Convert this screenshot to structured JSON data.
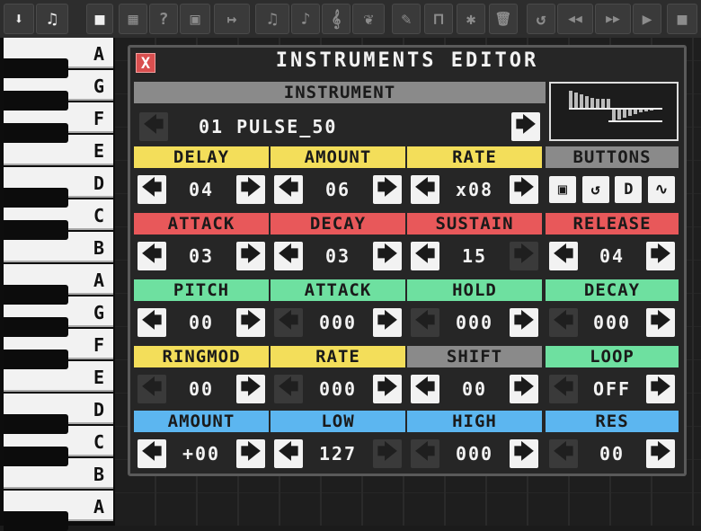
{
  "toolbar": {
    "icons": [
      "arrow-down-icon",
      "piano-icon",
      "stop-icon",
      "grid-icon",
      "help-icon",
      "save-icon",
      "export-icon",
      "piano-icon",
      "pitch-icon",
      "clef-icon",
      "bird-icon",
      "pencil-icon",
      "cup-icon",
      "asterisk-icon",
      "trash-icon",
      "undo-icon",
      "rewind-icon",
      "fast-forward-icon",
      "play-icon",
      "stop-icon"
    ],
    "glyphs": {
      "arrow_down": "⬇",
      "piano": "♫",
      "stop": "■",
      "grid": "▦",
      "help": "?",
      "save": "▣",
      "export": "↦",
      "pitch": "♪",
      "clef": "𝄞",
      "bird": "❦",
      "pencil": "✎",
      "cup": "⊓",
      "asterisk": "✱",
      "trash": "🗑",
      "undo": "↺",
      "rewind": "◀◀",
      "fast_forward": "▶▶",
      "play": "▶"
    }
  },
  "piano_keys": [
    "A",
    "G",
    "F",
    "E",
    "D",
    "C",
    "B",
    "A",
    "G",
    "F",
    "E",
    "D",
    "C",
    "B",
    "A"
  ],
  "modal": {
    "title": "INSTRUMENTS EDITOR",
    "close_label": "X",
    "instrument_header": "INSTRUMENT",
    "instrument_name": "01 PULSE_50",
    "sections": [
      {
        "headers": [
          "DELAY",
          "AMOUNT",
          "RATE",
          "BUTTONS"
        ],
        "color": "yellow",
        "values": [
          "04",
          "06",
          "x08"
        ]
      },
      {
        "headers": [
          "ATTACK",
          "DECAY",
          "SUSTAIN",
          "RELEASE"
        ],
        "color": "red",
        "values": [
          "03",
          "03",
          "15",
          "04"
        ]
      },
      {
        "headers": [
          "PITCH",
          "ATTACK",
          "HOLD",
          "DECAY"
        ],
        "color": "green",
        "values": [
          "00",
          "000",
          "000",
          "000"
        ]
      },
      {
        "headers": [
          "RINGMOD",
          "RATE",
          "SHIFT",
          "LOOP"
        ],
        "color": "mixed",
        "values": [
          "00",
          "000",
          "00",
          "OFF"
        ]
      },
      {
        "headers": [
          "AMOUNT",
          "LOW",
          "HIGH",
          "RES"
        ],
        "color": "blue",
        "values": [
          "+00",
          "127",
          "000",
          "00"
        ]
      }
    ],
    "buttons_icons": [
      "save-icon",
      "undo-icon",
      "d-shape-icon",
      "wave-icon"
    ],
    "arrow_left": "🡄",
    "arrow_right": "🡆"
  },
  "colors": {
    "yellow": "#f3de5a",
    "red": "#e8585a",
    "green": "#6ee0a0",
    "blue": "#5cb6f0",
    "gray": "#8a8a8a"
  }
}
